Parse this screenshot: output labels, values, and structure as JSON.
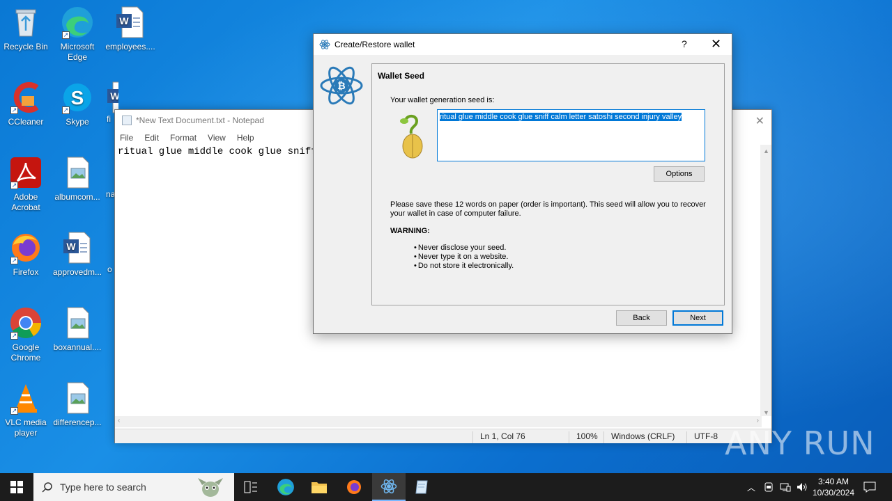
{
  "desktop": {
    "icons": [
      {
        "label": "Recycle Bin"
      },
      {
        "label": "Microsoft Edge"
      },
      {
        "label": "employees...."
      },
      {
        "label": "CCleaner"
      },
      {
        "label": "Skype"
      },
      {
        "label": "fi"
      },
      {
        "label": "Adobe Acrobat"
      },
      {
        "label": "albumcom..."
      },
      {
        "label": "na"
      },
      {
        "label": "Firefox"
      },
      {
        "label": "approvedm..."
      },
      {
        "label": "o"
      },
      {
        "label": "Google Chrome"
      },
      {
        "label": "boxannual...."
      },
      {
        "label": "VLC media player"
      },
      {
        "label": "differencep..."
      }
    ]
  },
  "notepad": {
    "title": "*New Text Document.txt - Notepad",
    "menu": [
      "File",
      "Edit",
      "Format",
      "View",
      "Help"
    ],
    "content": "ritual glue middle cook glue sniff c",
    "status": {
      "position": "Ln 1, Col 76",
      "zoom": "100%",
      "line_endings": "Windows (CRLF)",
      "encoding": "UTF-8"
    }
  },
  "dialog": {
    "title": "Create/Restore wallet",
    "help": "?",
    "panel_title": "Wallet Seed",
    "seed_label": "Your wallet generation seed is:",
    "seed": "ritual glue middle cook glue sniff calm letter satoshi second injury valley",
    "options_button": "Options",
    "info": "Please save these 12 words on paper (order is important). This seed will allow you to recover your wallet in case of computer failure.",
    "warning_label": "WARNING:",
    "warnings": [
      "Never disclose your seed.",
      "Never type it on a website.",
      "Do not store it electronically."
    ],
    "back_button": "Back",
    "next_button": "Next"
  },
  "watermark": "ANY RUN",
  "taskbar": {
    "search_placeholder": "Type here to search",
    "clock_time": "3:40 AM",
    "clock_date": "10/30/2024"
  },
  "colors": {
    "accent": "#0078d7",
    "taskbar": "#1c1c1c",
    "electrum": "#2a7ab8"
  }
}
